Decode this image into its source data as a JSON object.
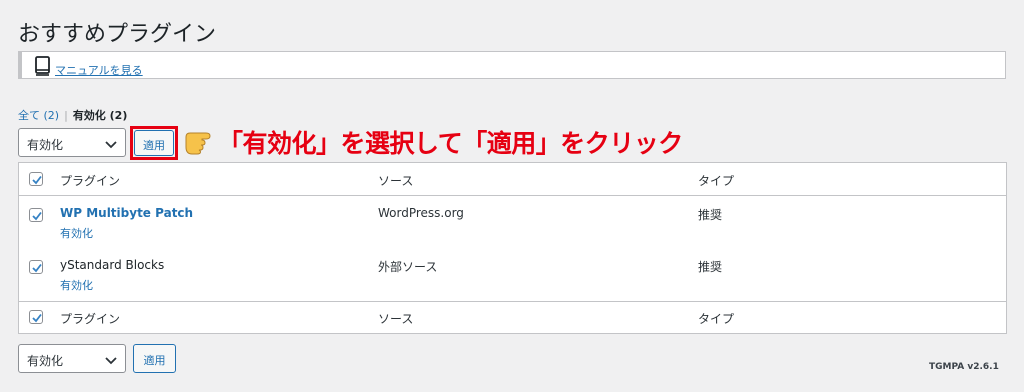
{
  "page": {
    "title": "おすすめプラグイン"
  },
  "notice": {
    "link": "マニュアルを見る"
  },
  "views": {
    "all_label": "全て",
    "all_count": "(2)",
    "separator": "|",
    "active_label": "有効化",
    "active_count": "(2)"
  },
  "bulk_top": {
    "selected": "有効化",
    "apply_label": "適用"
  },
  "bulk_bottom": {
    "selected": "有効化",
    "apply_label": "適用"
  },
  "annotation": {
    "text": "「有効化」を選択して「適用」をクリック",
    "color": "#e60012"
  },
  "table": {
    "columns": [
      "プラグイン",
      "ソース",
      "タイプ"
    ],
    "rows": [
      {
        "name": "WP Multibyte Patch",
        "action": "有効化",
        "source": "WordPress.org",
        "type": "推奨",
        "checked": true
      },
      {
        "name": "yStandard Blocks",
        "action": "有効化",
        "source": "外部ソース",
        "type": "推奨",
        "checked": true
      }
    ]
  },
  "version": "TGMPA v2.6.1",
  "colors": {
    "link": "#2271b1",
    "accent_red": "#e60012",
    "checkbox": "#3582c4"
  }
}
